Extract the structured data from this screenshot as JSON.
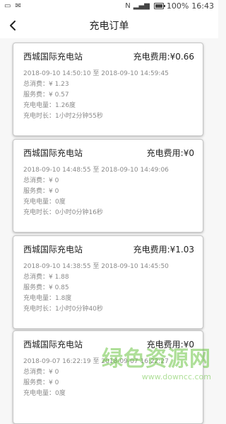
{
  "status_bar": {
    "left_icons": [
      "sim-icon",
      "mail-icon"
    ],
    "right_text": "N",
    "battery_text": "100%",
    "time": "16:43",
    "battery_level": 1.0
  },
  "header": {
    "title": "充电订单",
    "back_icon": "chevron-left-icon"
  },
  "orders": [
    {
      "station": "西城国际充电站",
      "fee": "充电费用:¥0.66",
      "time_range": "2018-09-10 14:50:10  至 2018-09-10 14:59:45",
      "total": "总消费：¥ 1.23",
      "service": "服务费：¥ 0.57",
      "energy": "充电电量：1.26度",
      "duration": "充电时长：1小时2分钟55秒"
    },
    {
      "station": "西城国际充电站",
      "fee": "充电费用:¥0",
      "time_range": "2018-09-10 14:48:55  至 2018-09-10 14:49:06",
      "total": "总消费：¥ 0",
      "service": "服务费：¥ 0",
      "energy": "充电电量：0度",
      "duration": "充电时长：0小时0分钟16秒"
    },
    {
      "station": "西城国际充电站",
      "fee": "充电费用:¥1.03",
      "time_range": "2018-09-10 14:38:55  至 2018-09-10 14:45:50",
      "total": "总消费：¥ 1.88",
      "service": "服务费：¥ 0.85",
      "energy": "充电电量：1.8度",
      "duration": "充电时长：1小时0分钟40秒"
    },
    {
      "station": "西城国际充电站",
      "fee": "充电费用:¥0",
      "time_range": "2018-09-07 16:22:19  至 2018-09-07 16:22:27",
      "total": "总消费：¥ 0",
      "service": "服务费：¥ 0",
      "energy": "充电电量：0度",
      "duration": ""
    }
  ],
  "watermark": {
    "main": "绿色资源网",
    "sub": "www.downcc.com"
  }
}
